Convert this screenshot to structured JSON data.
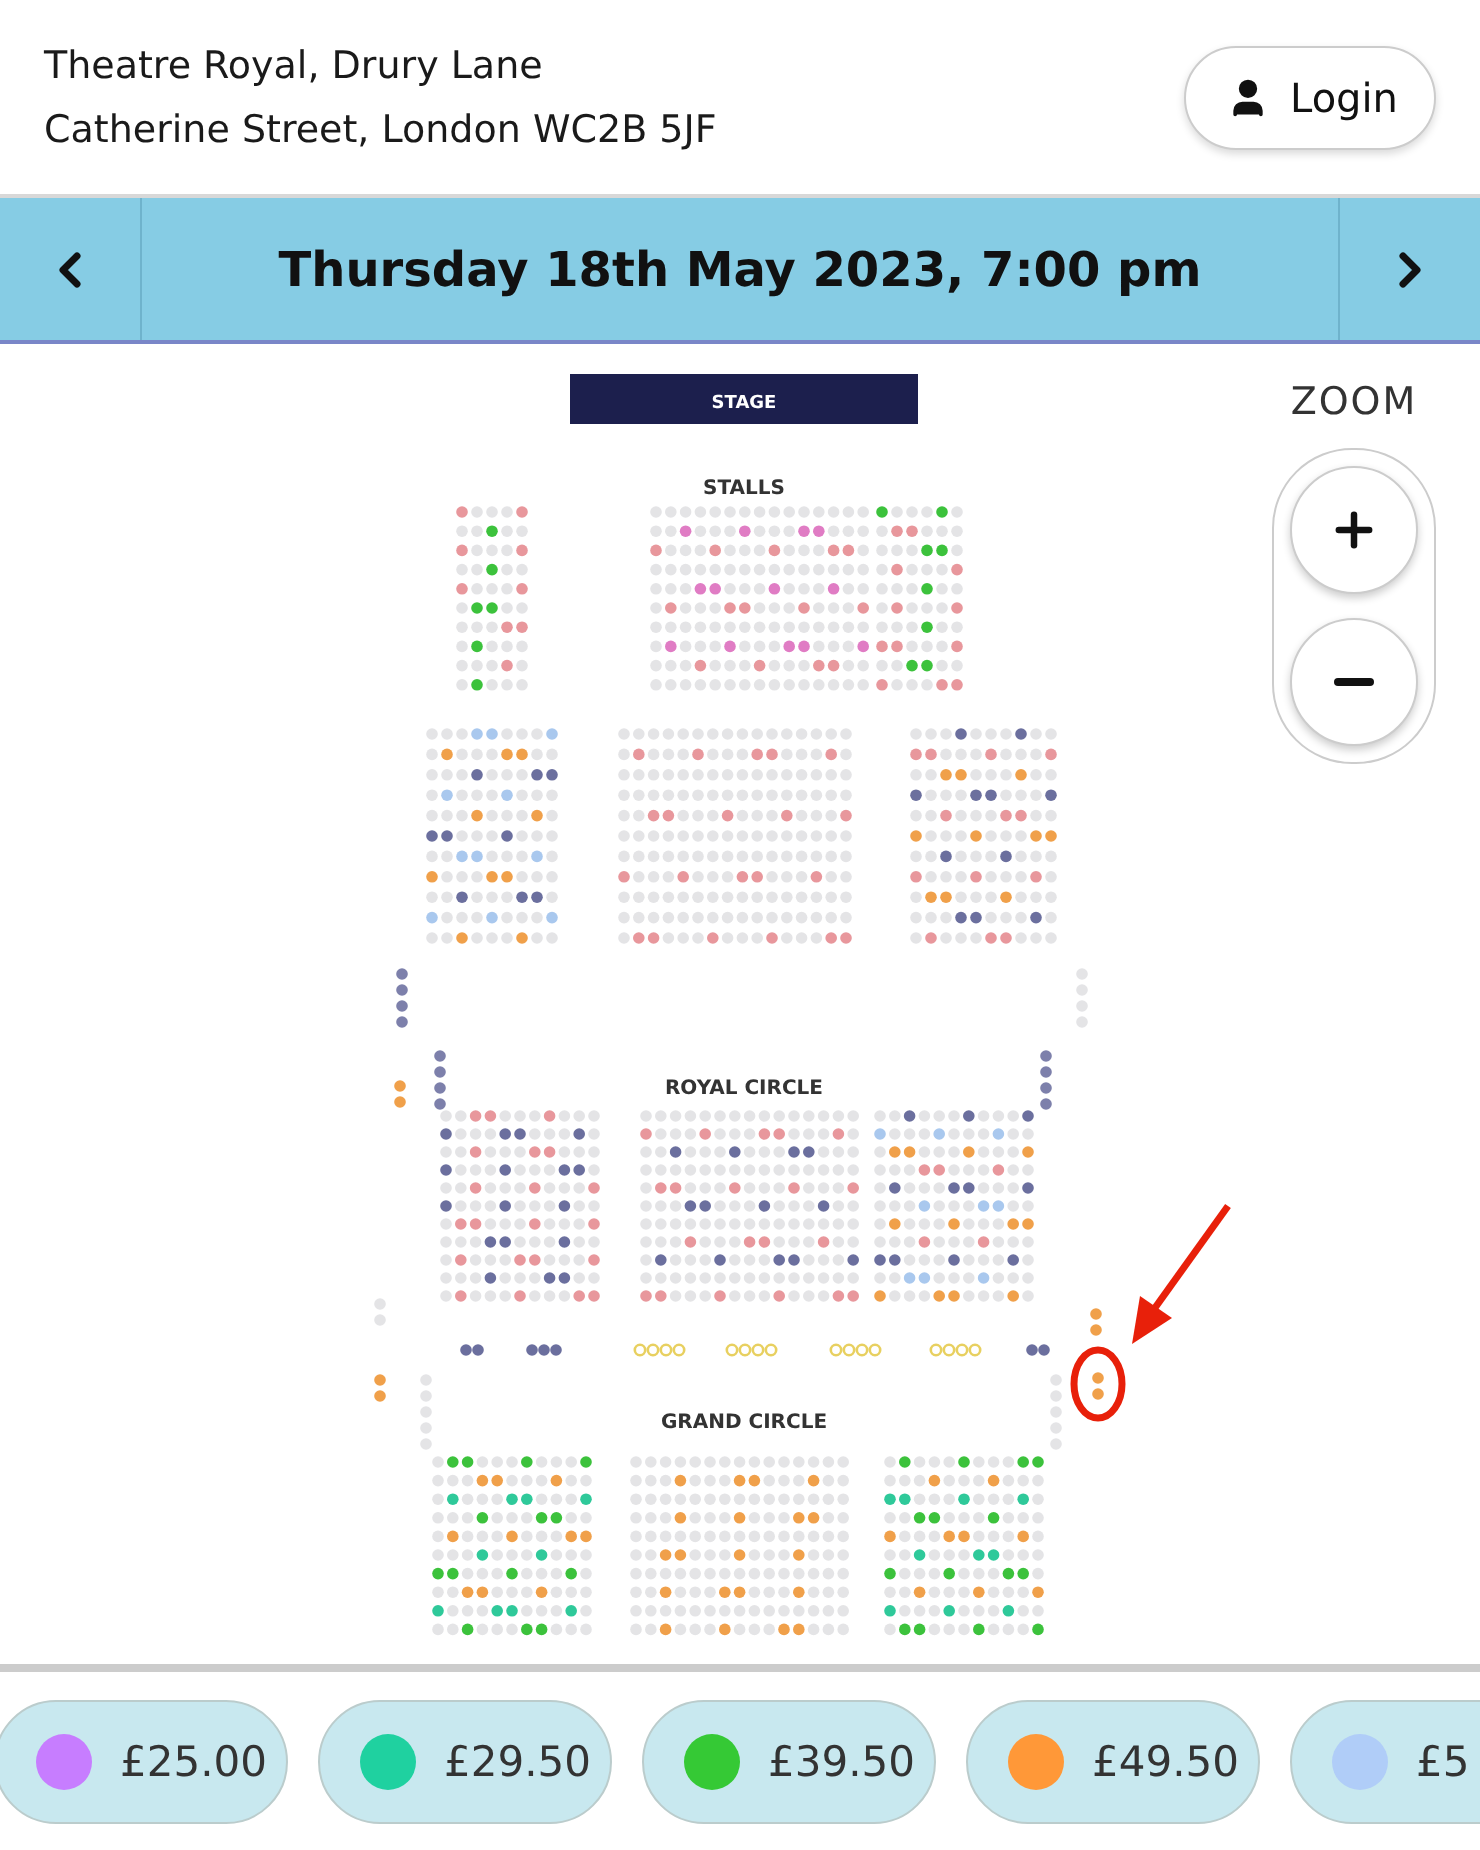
{
  "venue": {
    "name": "Theatre Royal, Drury Lane",
    "address": "Catherine Street, London WC2B 5JF"
  },
  "login": {
    "label": "Login"
  },
  "date_nav": {
    "date": "Thursday 18th May 2023, 7:00 pm"
  },
  "seat_map": {
    "stage": "STAGE",
    "sections": [
      {
        "label": "STALLS"
      },
      {
        "label": "ROYAL CIRCLE"
      },
      {
        "label": "GRAND CIRCLE"
      }
    ]
  },
  "zoom": {
    "label": "ZOOM"
  },
  "prices": [
    {
      "label": "£25.00",
      "color": "#c77dff"
    },
    {
      "label": "£29.50",
      "color": "#1fd1a0"
    },
    {
      "label": "£39.50",
      "color": "#35c935"
    },
    {
      "label": "£49.50",
      "color": "#ff9838"
    },
    {
      "label": "£5",
      "color": "#b0cdf8"
    }
  ]
}
